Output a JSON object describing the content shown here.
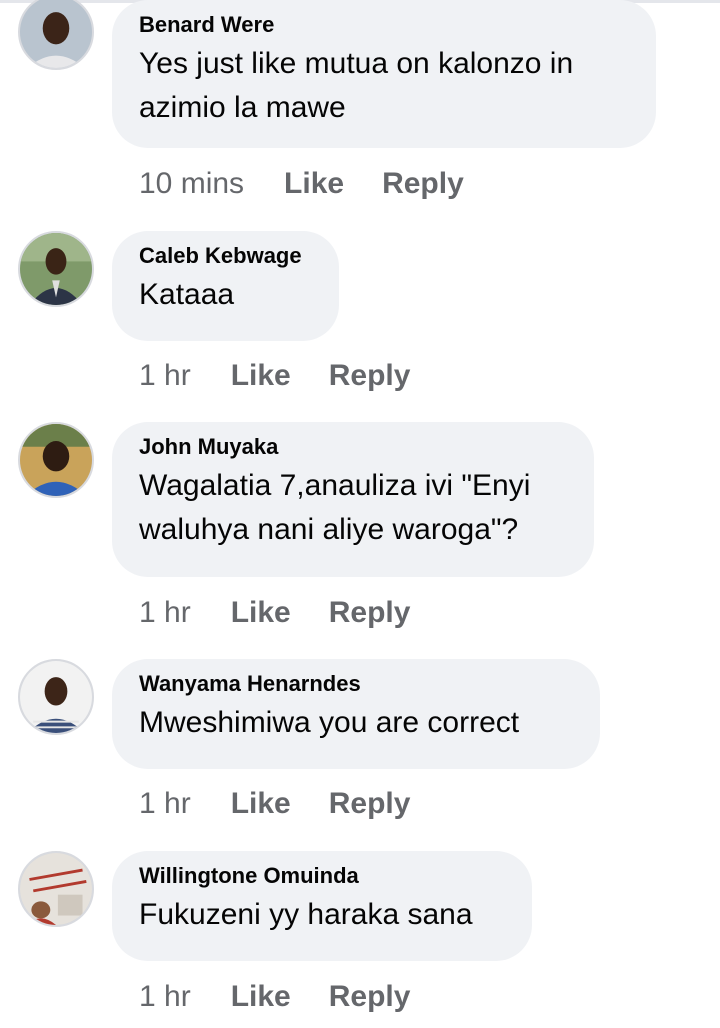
{
  "comments": [
    {
      "author": "Benard Were",
      "text": "Yes just like mutua on kalonzo in azimio la mawe",
      "time": "10 mins",
      "like": "Like",
      "reply": "Reply",
      "avatar_colors": {
        "bg": "#b9c4cf",
        "skin": "#3b2418",
        "shirt": "#e8e8ea"
      }
    },
    {
      "author": "Caleb Kebwage",
      "text": "Kataaa",
      "time": "1 hr",
      "like": "Like",
      "reply": "Reply",
      "avatar_colors": {
        "bg": "#7f9a6a",
        "skin": "#3a2416",
        "shirt": "#2c3446"
      }
    },
    {
      "author": "John Muyaka",
      "text": "Wagalatia 7,anauliza ivi \"Enyi waluhya nani aliye waroga\"?",
      "time": "1 hr",
      "like": "Like",
      "reply": "Reply",
      "avatar_colors": {
        "bg": "#c9a35a",
        "skin": "#2e1c12",
        "shirt": "#2f62b8"
      }
    },
    {
      "author": "Wanyama Henarndes",
      "text": "Mweshimiwa you are correct",
      "time": "1 hr",
      "like": "Like",
      "reply": "Reply",
      "avatar_colors": {
        "bg": "#f2f2f2",
        "skin": "#3d2518",
        "shirt": "#3a4f7a"
      }
    },
    {
      "author": "Willingtone Omuinda",
      "text": "Fukuzeni yy haraka sana",
      "time": "1 hr",
      "like": "Like",
      "reply": "Reply",
      "avatar_colors": {
        "bg": "#e6e2dc",
        "skin": "#8a5a3c",
        "shirt": "#b23a2e"
      }
    }
  ]
}
